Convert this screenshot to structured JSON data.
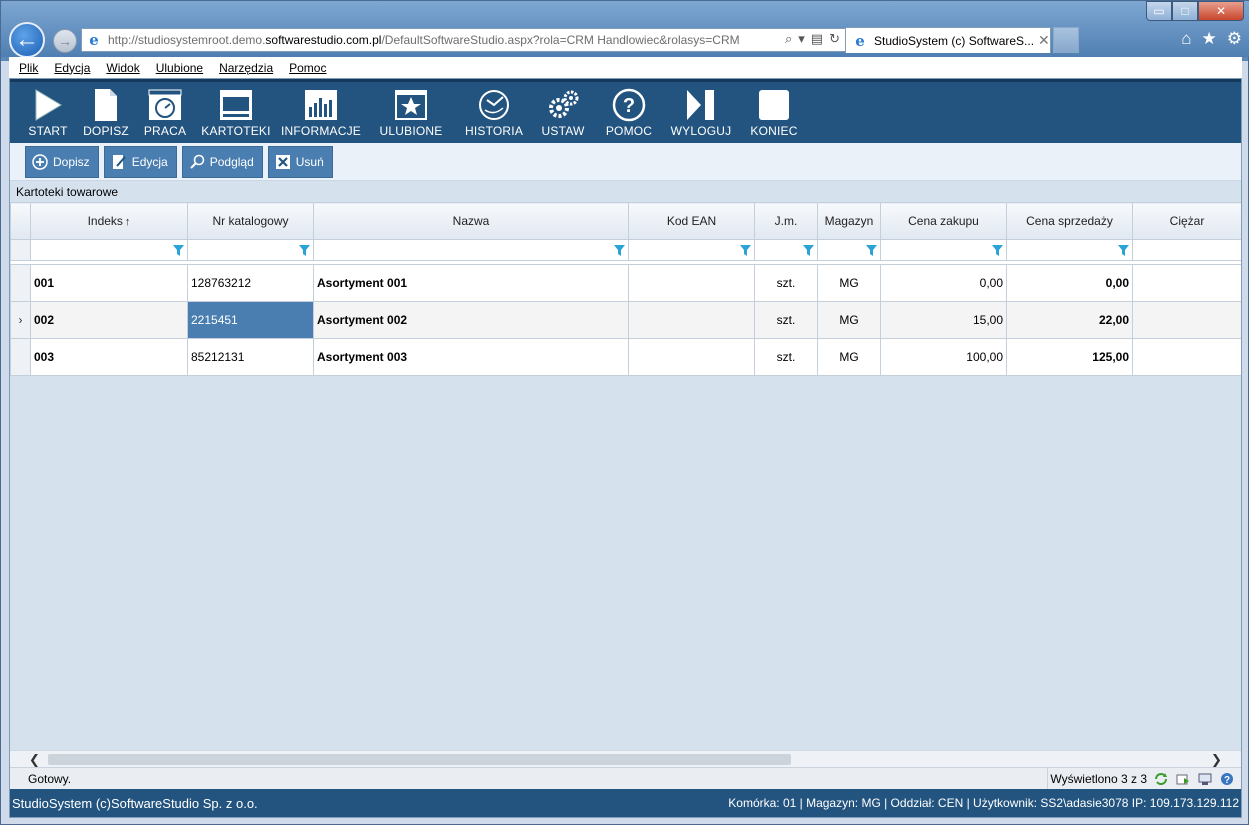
{
  "window": {
    "minimize": "▭",
    "maximize": "□",
    "close": "✕"
  },
  "browser": {
    "address_host_prefix": "http://studiosystemroot.demo.",
    "address_host_bold": "softwarestudio.com.pl",
    "address_path": "/DefaultSoftwareStudio.aspx?rola=CRM Handlowiec&rolasys=CRM",
    "tab_title": "StudioSystem (c) SoftwareS...",
    "tab_close": "✕"
  },
  "menu": [
    "Plik",
    "Edycja",
    "Widok",
    "Ulubione",
    "Narzędzia",
    "Pomoc"
  ],
  "toolbar": [
    {
      "label": "START",
      "icon": "play-icon"
    },
    {
      "label": "DOPISZ",
      "icon": "new-document-icon"
    },
    {
      "label": "PRACA",
      "icon": "work-clock-icon"
    },
    {
      "label": "KARTOTEKI",
      "icon": "window-icon"
    },
    {
      "label": "INFORMACJE",
      "icon": "bar-chart-icon"
    },
    {
      "label": "ULUBIONE",
      "icon": "star-icon"
    },
    {
      "label": "HISTORIA",
      "icon": "history-icon"
    },
    {
      "label": "USTAW",
      "icon": "gears-icon"
    },
    {
      "label": "POMOC",
      "icon": "help-icon"
    },
    {
      "label": "WYLOGUJ",
      "icon": "logout-icon"
    },
    {
      "label": "KONIEC",
      "icon": "stop-icon"
    }
  ],
  "actions": [
    {
      "label": "Dopisz",
      "icon": "plus-circle-icon"
    },
    {
      "label": "Edycja",
      "icon": "edit-icon"
    },
    {
      "label": "Podgląd",
      "icon": "magnifier-icon"
    },
    {
      "label": "Usuń",
      "icon": "delete-icon"
    }
  ],
  "section_title": "Kartoteki towarowe",
  "grid": {
    "columns": [
      "Indeks",
      "Nr katalogowy",
      "Nazwa",
      "Kod EAN",
      "J.m.",
      "Magazyn",
      "Cena zakupu",
      "Cena sprzedaży",
      "Ciężar"
    ],
    "sort_indicator": "↑",
    "current_row_marker": "›",
    "rows": [
      {
        "indeks": "001",
        "nr_katalogowy": "128763212",
        "nazwa": "Asortyment 001",
        "kod_ean": "",
        "jm": "szt.",
        "magazyn": "MG",
        "cena_zakupu": "0,00",
        "cena_sprzedazy": "0,00",
        "ciezar": ""
      },
      {
        "indeks": "002",
        "nr_katalogowy": "2215451",
        "nazwa": "Asortyment 002",
        "kod_ean": "",
        "jm": "szt.",
        "magazyn": "MG",
        "cena_zakupu": "15,00",
        "cena_sprzedazy": "22,00",
        "ciezar": ""
      },
      {
        "indeks": "003",
        "nr_katalogowy": "85212131",
        "nazwa": "Asortyment 003",
        "kod_ean": "",
        "jm": "szt.",
        "magazyn": "MG",
        "cena_zakupu": "100,00",
        "cena_sprzedazy": "125,00",
        "ciezar": ""
      }
    ]
  },
  "status": {
    "left": "Gotowy.",
    "count": "Wyświetlono 3 z 3"
  },
  "footer": {
    "left": "StudioSystem (c)SoftwareStudio Sp. z o.o.",
    "right": "Komórka: 01 | Magazyn: MG | Oddział: CEN | Użytkownik: SS2\\adasie3078 IP: 109.173.129.112"
  },
  "colors": {
    "toolbar_bg": "#23547f",
    "action_button": "#4a7eb1",
    "selected_cell": "#4a7eb1",
    "filter_icon": "#2aa3d6"
  }
}
